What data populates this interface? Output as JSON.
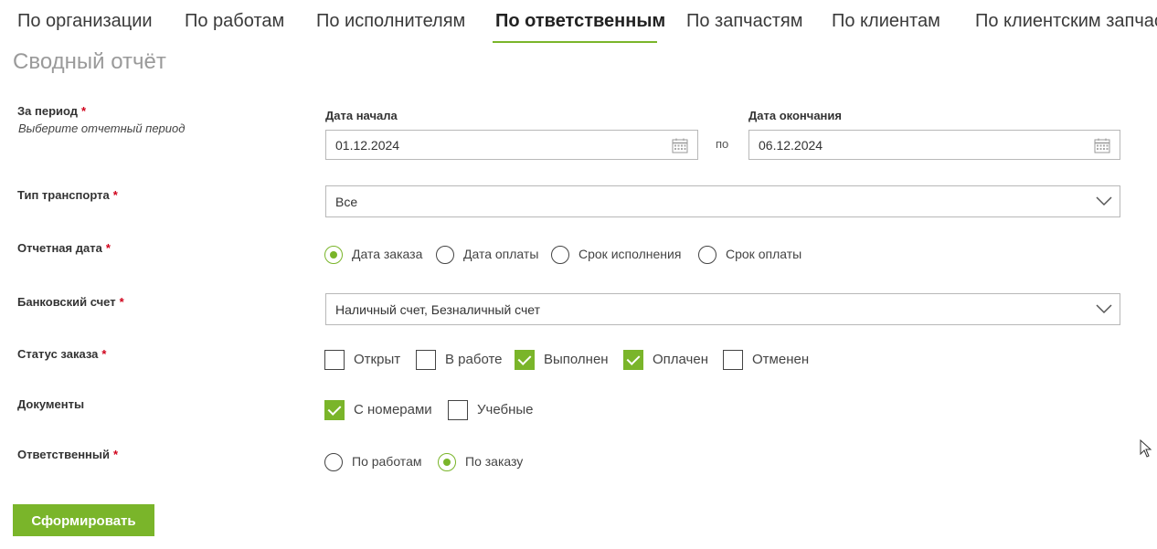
{
  "tabs": [
    {
      "label": "По организации",
      "active": false
    },
    {
      "label": "По работам",
      "active": false
    },
    {
      "label": "По исполнителям",
      "active": false
    },
    {
      "label": "По ответственным",
      "active": true
    },
    {
      "label": "По запчастям",
      "active": false
    },
    {
      "label": "По клиентам",
      "active": false
    },
    {
      "label": "По клиентским запчастям",
      "active": false
    }
  ],
  "title": "Сводный отчёт",
  "period": {
    "label": "За период",
    "required": "*",
    "hint": "Выберите отчетный период",
    "start_label": "Дата начала",
    "start_value": "01.12.2024",
    "separator": "по",
    "end_label": "Дата окончания",
    "end_value": "06.12.2024"
  },
  "transport": {
    "label": "Тип транспорта",
    "required": "*",
    "value": "Все"
  },
  "report_date": {
    "label": "Отчетная дата",
    "required": "*",
    "options": [
      {
        "label": "Дата заказа",
        "selected": true
      },
      {
        "label": "Дата оплаты",
        "selected": false
      },
      {
        "label": "Срок исполнения",
        "selected": false
      },
      {
        "label": "Срок оплаты",
        "selected": false
      }
    ]
  },
  "bank_account": {
    "label": "Банковский счет",
    "required": "*",
    "value": "Наличный счет, Безналичный счет"
  },
  "order_status": {
    "label": "Статус заказа",
    "required": "*",
    "options": [
      {
        "label": "Открыт",
        "checked": false
      },
      {
        "label": "В работе",
        "checked": false
      },
      {
        "label": "Выполнен",
        "checked": true
      },
      {
        "label": "Оплачен",
        "checked": true
      },
      {
        "label": "Отменен",
        "checked": false
      }
    ]
  },
  "documents": {
    "label": "Документы",
    "options": [
      {
        "label": "С номерами",
        "checked": true
      },
      {
        "label": "Учебные",
        "checked": false
      }
    ]
  },
  "responsible": {
    "label": "Ответственный",
    "required": "*",
    "options": [
      {
        "label": "По работам",
        "selected": false
      },
      {
        "label": "По заказу",
        "selected": true
      }
    ]
  },
  "submit_label": "Сформировать",
  "colors": {
    "accent": "#7ab52a",
    "required": "#d0021b"
  },
  "icons": [
    "calendar-icon",
    "chevron-down-icon",
    "mouse-cursor-icon"
  ]
}
